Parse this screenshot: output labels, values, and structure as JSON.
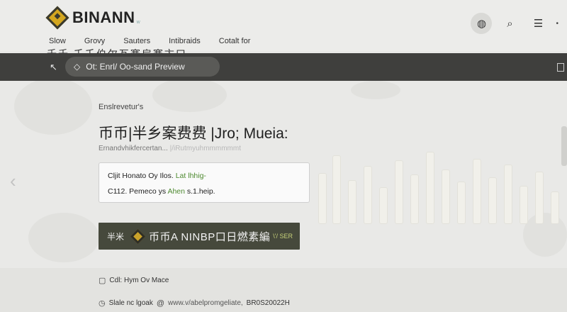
{
  "brand": {
    "name": "BINANN",
    "tagline": "w"
  },
  "nav": {
    "items": [
      "Slow",
      "Grovy",
      "Sauters",
      "Intibraids",
      "Cotalt for"
    ]
  },
  "header_actions": {
    "globe": "◍",
    "search": "⌕",
    "menu": "☰",
    "more": "•"
  },
  "cjk_strip": "千千   壬壬伯尔瓦赛扁赛卞口",
  "preview_bar": {
    "back": "↖",
    "text": "Ot: Enrl/ Oo-sand Preview"
  },
  "content": {
    "eyebrow": "Enslrevetur's",
    "headline": "币币|半乡案费费 |Jro; Mueia:",
    "subline": "Ernandvhikfercertan...",
    "subline_faint": "|/iRutmyuhmmmmmmt",
    "card": {
      "row1_main": "Cljit Honato Oy Ilos.",
      "row1_accent": "Lat lhhig-",
      "row2_main": "C112. Pemeco ys",
      "row2_accent": "Ahen",
      "row2_tail": "s.1.heip."
    },
    "cta": {
      "prefix": "半米",
      "main": "币币A NINBP口日燃素編",
      "tag": "\\'/ SER"
    },
    "info1": "Cdl: Hym Ov Mace",
    "info2_label": "Slale nc lgoak",
    "info2_link": "www.v/abelpromgeliate,",
    "info2_code": "BR0S20022H"
  },
  "colors": {
    "accent": "#d4a71f",
    "dark_bar": "#3f3f3d",
    "cta": "#46493c"
  }
}
